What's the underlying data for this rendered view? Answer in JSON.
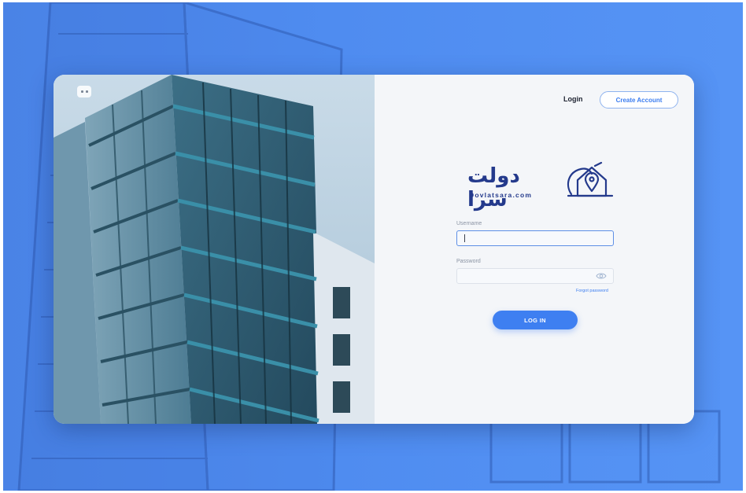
{
  "header": {
    "login_label": "Login",
    "create_account_label": "Create Account"
  },
  "brand": {
    "name_fa": "دولت سرا",
    "domain": "Dovlatsara.com",
    "logo_icon": "house-location-pin-icon"
  },
  "form": {
    "username_label": "Username",
    "username_value": "",
    "password_label": "Password",
    "password_value": "",
    "password_toggle_icon": "eye-icon",
    "forgot_label": "Forgot password",
    "submit_label": "LOG IN"
  },
  "photo": {
    "expand_icon": "expand-icon"
  },
  "colors": {
    "accent": "#3e7ff1",
    "brand_navy": "#243a8c",
    "backdrop": "#4f8cf0",
    "panel": "#f4f6f9"
  }
}
